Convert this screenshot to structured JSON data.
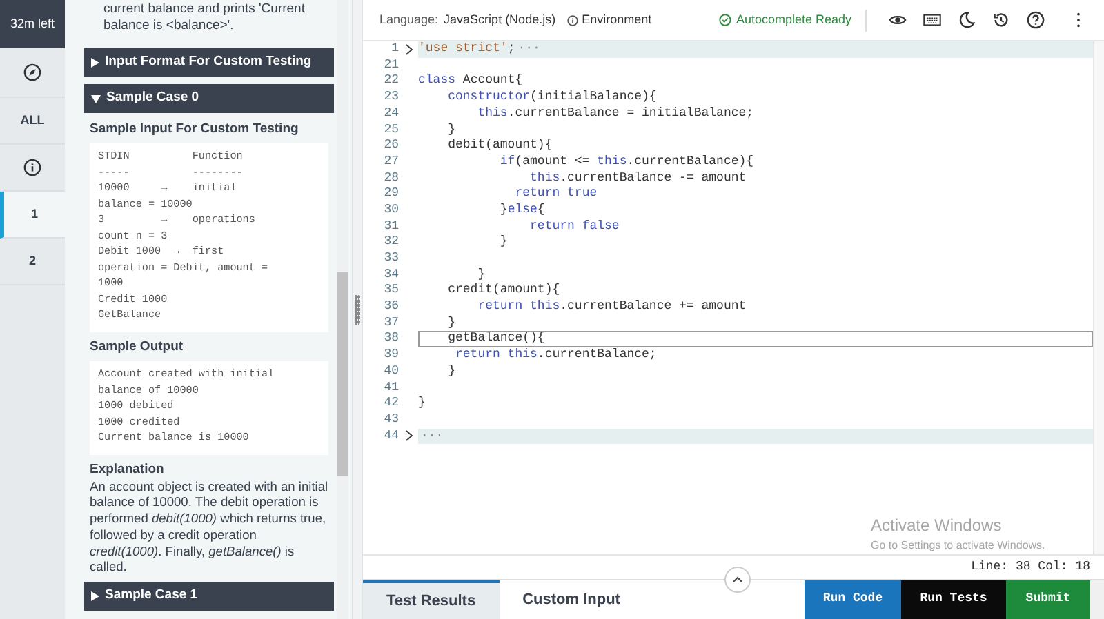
{
  "nav": {
    "timer": "32m left",
    "items": [
      {
        "kind": "compass",
        "selected": false
      },
      {
        "kind": "text",
        "label": "ALL",
        "selected": false
      },
      {
        "kind": "info",
        "selected": false
      },
      {
        "kind": "text",
        "label": "1",
        "selected": true
      },
      {
        "kind": "text",
        "label": "2",
        "selected": false
      }
    ]
  },
  "problem": {
    "intro": "current balance and prints 'Current balance is <balance>'.",
    "sections": [
      {
        "title": "Input Format For Custom Testing",
        "expanded": false
      },
      {
        "title": "Sample Case 0",
        "expanded": true,
        "input_heading": "Sample Input For Custom Testing",
        "input_lines": [
          "STDIN          Function",
          "-----          --------",
          "10000     →    initial",
          "balance = 10000",
          "3         →    operations",
          "count n = 3",
          "Debit 1000  →  first",
          "operation = Debit, amount =",
          "1000",
          "Credit 1000",
          "GetBalance"
        ],
        "output_heading": "Sample Output",
        "output_lines": [
          "Account created with initial",
          "balance of 10000",
          "1000 debited",
          "1000 credited",
          "Current balance is 10000"
        ],
        "explanation_heading": "Explanation",
        "explanation": "An account object is created with an initial balance of 10000. The debit operation is performed *debit(1000)* which returns true, followed by a credit operation *credit(1000)*. Finally, *getBalance()* is called."
      },
      {
        "title": "Sample Case 1",
        "expanded": false
      }
    ]
  },
  "toolbar": {
    "language_label": "Language:",
    "language": "JavaScript (Node.js)",
    "environment": "Environment",
    "autocomplete": "Autocomplete Ready"
  },
  "editor": {
    "lines": [
      {
        "num": "1",
        "folded": true,
        "tokens": [
          {
            "kind": "string",
            "text": "'use strict'"
          },
          {
            "kind": "plain",
            "text": ";"
          }
        ]
      },
      {
        "num": "21"
      },
      {
        "num": "22",
        "tokens": [
          {
            "kind": "keyword",
            "text": "class"
          },
          {
            "kind": "plain",
            "text": " Account{"
          }
        ]
      },
      {
        "num": "23",
        "tokens": [
          {
            "kind": "keyword",
            "text": "    constructor"
          },
          {
            "kind": "plain",
            "text": "(initialBalance){"
          }
        ]
      },
      {
        "num": "24",
        "tokens": [
          {
            "kind": "keyword",
            "text": "        this"
          },
          {
            "kind": "plain",
            "text": ".currentBalance = initialBalance;"
          }
        ]
      },
      {
        "num": "25",
        "tokens": [
          {
            "kind": "plain",
            "text": "    }"
          }
        ]
      },
      {
        "num": "26",
        "tokens": [
          {
            "kind": "plain",
            "text": "    debit(amount){"
          }
        ]
      },
      {
        "num": "27",
        "tokens": [
          {
            "kind": "keyword",
            "text": "           if"
          },
          {
            "kind": "plain",
            "text": "(amount <= "
          },
          {
            "kind": "keyword",
            "text": "this"
          },
          {
            "kind": "plain",
            "text": ".currentBalance){"
          }
        ]
      },
      {
        "num": "28",
        "tokens": [
          {
            "kind": "keyword",
            "text": "               this"
          },
          {
            "kind": "plain",
            "text": ".currentBalance -= amount"
          }
        ]
      },
      {
        "num": "29",
        "tokens": [
          {
            "kind": "keyword",
            "text": "             return true"
          }
        ]
      },
      {
        "num": "30",
        "tokens": [
          {
            "kind": "plain",
            "text": "           }"
          },
          {
            "kind": "keyword",
            "text": "else"
          },
          {
            "kind": "plain",
            "text": "{"
          }
        ]
      },
      {
        "num": "31",
        "tokens": [
          {
            "kind": "keyword",
            "text": "               return false"
          }
        ]
      },
      {
        "num": "32",
        "tokens": [
          {
            "kind": "plain",
            "text": "           }"
          }
        ]
      },
      {
        "num": "33"
      },
      {
        "num": "34",
        "tokens": [
          {
            "kind": "plain",
            "text": "        }"
          }
        ]
      },
      {
        "num": "35",
        "tokens": [
          {
            "kind": "plain",
            "text": "    credit(amount){"
          }
        ]
      },
      {
        "num": "36",
        "tokens": [
          {
            "kind": "keyword",
            "text": "        return this"
          },
          {
            "kind": "plain",
            "text": ".currentBalance += amount"
          }
        ]
      },
      {
        "num": "37",
        "tokens": [
          {
            "kind": "plain",
            "text": "    }"
          }
        ]
      },
      {
        "num": "38",
        "active": true,
        "tokens": [
          {
            "kind": "plain",
            "text": "    getBalance(){"
          }
        ]
      },
      {
        "num": "39",
        "tokens": [
          {
            "kind": "keyword",
            "text": "     return this"
          },
          {
            "kind": "plain",
            "text": ".currentBalance;"
          }
        ]
      },
      {
        "num": "40",
        "tokens": [
          {
            "kind": "plain",
            "text": "    }"
          }
        ]
      },
      {
        "num": "41"
      },
      {
        "num": "42",
        "tokens": [
          {
            "kind": "plain",
            "text": "}"
          }
        ]
      },
      {
        "num": "43"
      },
      {
        "num": "44",
        "folded": true
      }
    ],
    "fold_mark": "···"
  },
  "os_watermark": [
    "Activate Windows",
    "Go to Settings to activate Windows."
  ],
  "status": "Line: 38 Col: 18",
  "bottom": {
    "tabs": [
      {
        "label": "Test Results",
        "selected": true
      },
      {
        "label": "Custom Input",
        "selected": false
      }
    ],
    "buttons": [
      {
        "kind": "run",
        "label": "Run Code"
      },
      {
        "kind": "tests",
        "label": "Run Tests"
      },
      {
        "kind": "submit",
        "label": "Submit"
      }
    ]
  }
}
